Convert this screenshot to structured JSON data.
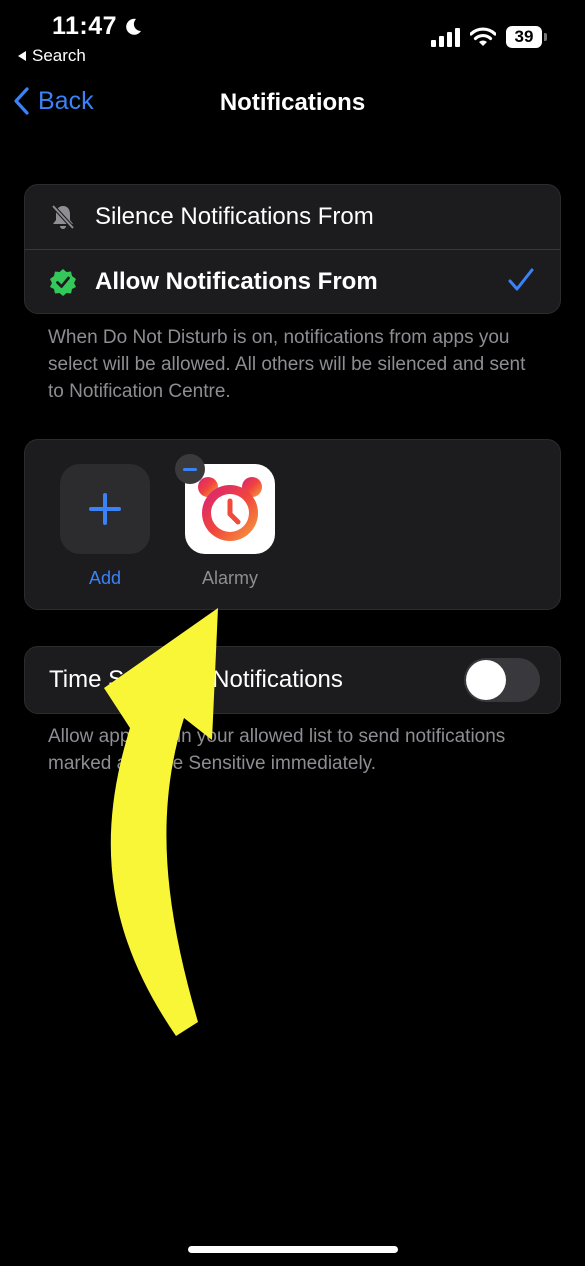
{
  "status_bar": {
    "time": "11:47",
    "back_app": "Search",
    "battery": "39"
  },
  "nav": {
    "back_label": "Back",
    "title": "Notifications"
  },
  "mode_options": [
    {
      "label": "Silence Notifications From",
      "icon": "bell-slash-icon",
      "selected": false
    },
    {
      "label": "Allow Notifications From",
      "icon": "checkmark-seal-icon",
      "selected": true
    }
  ],
  "mode_footnote": "When Do Not Disturb is on, notifications from apps you select will be allowed. All others will be silenced and sent to Notification Centre.",
  "apps": {
    "add_label": "Add",
    "items": [
      {
        "name": "Alarmy"
      }
    ]
  },
  "time_sensitive": {
    "label": "Time Sensitive Notifications",
    "enabled": false,
    "footnote": "Allow apps not in your allowed list to send notifications marked as Time Sensitive immediately."
  },
  "colors": {
    "accent": "#3b82f6",
    "background": "#000000",
    "card": "#1c1c1e",
    "arrow": "#f8f636",
    "seal": "#34c759"
  }
}
